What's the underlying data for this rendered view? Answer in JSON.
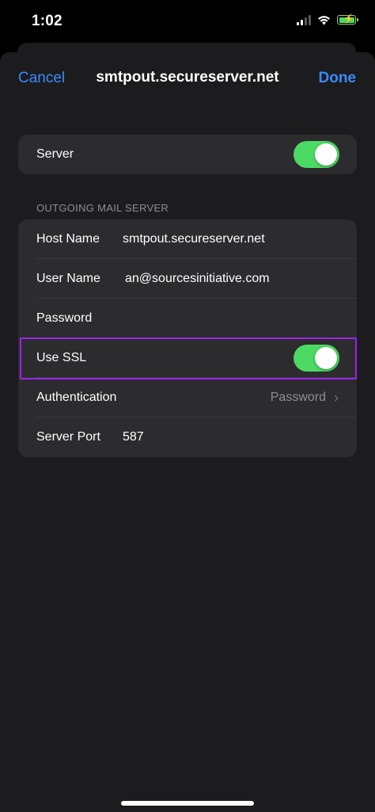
{
  "status_bar": {
    "time": "1:02"
  },
  "nav": {
    "cancel_label": "Cancel",
    "title": "smtpout.secureserver.net",
    "done_label": "Done"
  },
  "server_group": {
    "server_label": "Server",
    "server_enabled": true
  },
  "outgoing": {
    "section_header": "OUTGOING MAIL SERVER",
    "host_name_label": "Host Name",
    "host_name_value": "smtpout.secureserver.net",
    "user_name_label": "User Name",
    "user_name_value": "an@sourcesinitiative.com",
    "password_label": "Password",
    "password_value": "",
    "use_ssl_label": "Use SSL",
    "use_ssl_enabled": true,
    "authentication_label": "Authentication",
    "authentication_value": "Password",
    "server_port_label": "Server Port",
    "server_port_value": "587"
  },
  "colors": {
    "accent": "#3a8bff",
    "toggle_on": "#4cd964",
    "highlight": "#a020f0"
  },
  "icons": [
    "signal-icon",
    "wifi-icon",
    "battery-icon",
    "chevron-right-icon"
  ]
}
